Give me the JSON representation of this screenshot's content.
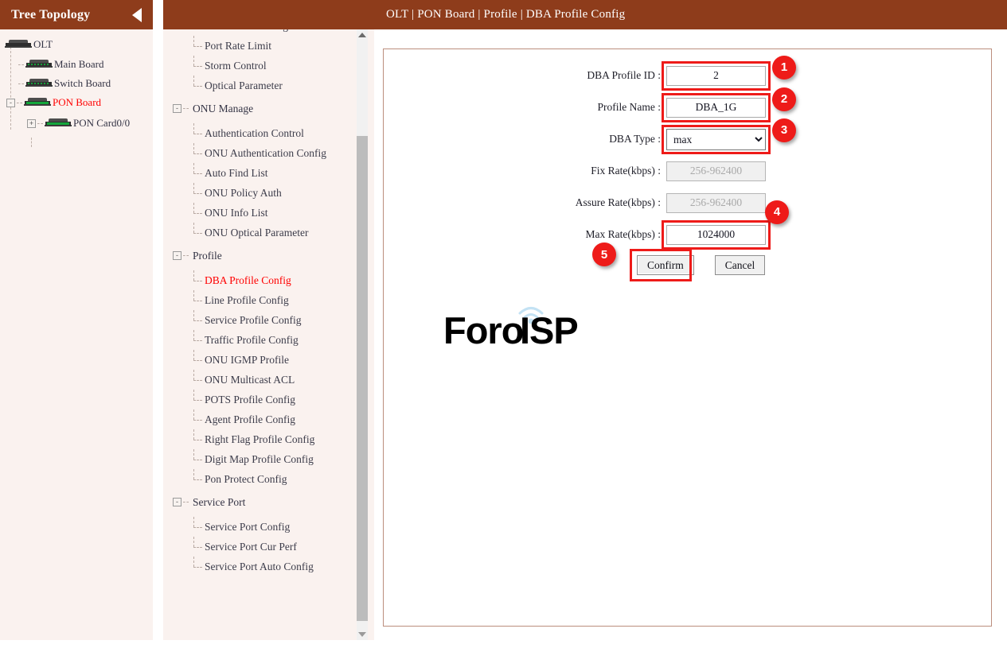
{
  "left_panel": {
    "title": "Tree Topology",
    "collapse_icon": "collapse-left-arrow-icon",
    "tree": [
      {
        "label": "OLT",
        "level": 0,
        "icon": "board-icon",
        "active": false,
        "expander": ""
      },
      {
        "label": "Main Board",
        "level": 1,
        "icon": "board-icon",
        "active": false,
        "expander": ""
      },
      {
        "label": "Switch Board",
        "level": 1,
        "icon": "board-icon",
        "active": false,
        "expander": ""
      },
      {
        "label": "PON Board",
        "level": 1,
        "icon": "board-icon",
        "active": true,
        "expander": "-"
      },
      {
        "label": "PON Card0/0",
        "level": 2,
        "icon": "board-icon",
        "active": false,
        "expander": "+"
      }
    ]
  },
  "mid_panel": {
    "partial_top_item": "",
    "groups": [
      {
        "group": null,
        "items": [
          {
            "label": "Port Extend Config",
            "active": false
          },
          {
            "label": "Port Rate Limit",
            "active": false
          },
          {
            "label": "Storm Control",
            "active": false
          },
          {
            "label": "Optical Parameter",
            "active": false
          }
        ]
      },
      {
        "group": "ONU Manage",
        "expander": "-",
        "items": [
          {
            "label": "Authentication Control",
            "active": false
          },
          {
            "label": "ONU Authentication Config",
            "active": false
          },
          {
            "label": "Auto Find List",
            "active": false
          },
          {
            "label": "ONU Policy Auth",
            "active": false
          },
          {
            "label": "ONU Info List",
            "active": false
          },
          {
            "label": "ONU Optical Parameter",
            "active": false
          }
        ]
      },
      {
        "group": "Profile",
        "expander": "-",
        "items": [
          {
            "label": "DBA Profile Config",
            "active": true
          },
          {
            "label": "Line Profile Config",
            "active": false
          },
          {
            "label": "Service Profile Config",
            "active": false
          },
          {
            "label": "Traffic Profile Config",
            "active": false
          },
          {
            "label": "ONU IGMP Profile",
            "active": false
          },
          {
            "label": "ONU Multicast ACL",
            "active": false
          },
          {
            "label": "POTS Profile Config",
            "active": false
          },
          {
            "label": "Agent Profile Config",
            "active": false
          },
          {
            "label": "Right Flag Profile Config",
            "active": false
          },
          {
            "label": "Digit Map Profile Config",
            "active": false
          },
          {
            "label": "Pon Protect Config",
            "active": false
          }
        ]
      },
      {
        "group": "Service Port",
        "expander": "-",
        "items": [
          {
            "label": "Service Port Config",
            "active": false
          },
          {
            "label": "Service Port Cur Perf",
            "active": false
          },
          {
            "label": "Service Port Auto Config",
            "active": false
          }
        ]
      }
    ],
    "scrollbar": {
      "up_icon": "scroll-up-arrow-icon",
      "down_icon": "scroll-down-arrow-icon"
    }
  },
  "main": {
    "breadcrumb": "OLT | PON Board | Profile | DBA Profile Config",
    "form": {
      "fields": [
        {
          "label": "DBA Profile ID :",
          "value": "2",
          "placeholder": "",
          "type": "text",
          "disabled": false,
          "highlight": true,
          "badge": "1"
        },
        {
          "label": "Profile Name :",
          "value": "DBA_1G",
          "placeholder": "",
          "type": "text",
          "disabled": false,
          "highlight": true,
          "badge": "2"
        },
        {
          "label": "DBA Type :",
          "value": "max",
          "placeholder": "",
          "type": "select",
          "disabled": false,
          "highlight": true,
          "badge": "3",
          "options": [
            "max"
          ]
        },
        {
          "label": "Fix Rate(kbps) :",
          "value": "",
          "placeholder": "256-962400",
          "type": "text",
          "disabled": true,
          "highlight": false,
          "badge": ""
        },
        {
          "label": "Assure Rate(kbps) :",
          "value": "",
          "placeholder": "256-962400",
          "type": "text",
          "disabled": true,
          "highlight": false,
          "badge": ""
        },
        {
          "label": "Max Rate(kbps) :",
          "value": "1024000",
          "placeholder": "",
          "type": "text",
          "disabled": false,
          "highlight": true,
          "badge": "4"
        }
      ],
      "confirm_label": "Confirm",
      "cancel_label": "Cancel",
      "confirm_badge": "5"
    },
    "watermark": {
      "part1": "Foro",
      "part2": "ISP"
    }
  },
  "colors": {
    "header_bar": "#8e3c1b",
    "panel_bg": "#faf2ef",
    "highlight": "#ee1b19",
    "active_link": "#ff0000",
    "panel_border": "#bb8e7d"
  }
}
